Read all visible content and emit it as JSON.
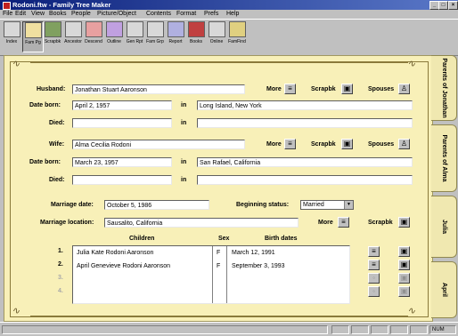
{
  "window": {
    "title": "Rodoni.ftw - Family Tree Maker",
    "controls": [
      "_",
      "□",
      "×"
    ]
  },
  "menu": [
    "File",
    "Edit",
    "View",
    "Books",
    "People",
    "Picture/Object",
    "Contents",
    "Format",
    "Prefs",
    "Help"
  ],
  "toolbar": [
    {
      "label": "Index",
      "icon": "index-icon"
    },
    {
      "label": "Fam Pg",
      "icon": "family-page-icon"
    },
    {
      "label": "Scrapbk",
      "icon": "scrapbook-icon"
    },
    {
      "label": "Ancestor",
      "icon": "ancestor-tree-icon"
    },
    {
      "label": "Descend",
      "icon": "descendant-tree-icon"
    },
    {
      "label": "Outline",
      "icon": "outline-icon"
    },
    {
      "label": "Gen Rpt",
      "icon": "genealogy-report-icon"
    },
    {
      "label": "Fam Grp",
      "icon": "family-group-icon"
    },
    {
      "label": "Report",
      "icon": "report-icon"
    },
    {
      "label": "Books",
      "icon": "books-icon"
    },
    {
      "label": "Online",
      "icon": "online-icon"
    },
    {
      "label": "FamFind",
      "icon": "family-finder-icon"
    }
  ],
  "form": {
    "husband_label": "Husband:",
    "husband": "Jonathan Stuart Aaronson",
    "date_born_label": "Date born:",
    "husband_born": "April 2, 1957",
    "in_label": "in",
    "husband_born_place": "Long Island, New York",
    "died_label": "Died:",
    "husband_died": "",
    "husband_died_place": "",
    "wife_label": "Wife:",
    "wife": "Alma Cecilia Rodoni",
    "wife_born": "March 23, 1957",
    "wife_born_place": "San Rafael, California",
    "wife_died": "",
    "wife_died_place": "",
    "more_label": "More",
    "scrapbk_label": "Scrapbk",
    "spouses_label": "Spouses",
    "marriage_date_label": "Marriage date:",
    "marriage_date": "October 5, 1986",
    "beginning_status_label": "Beginning status:",
    "beginning_status": "Married",
    "marriage_location_label": "Marriage location:",
    "marriage_location": "Sausalito, California"
  },
  "children": {
    "headers": {
      "children": "Children",
      "sex": "Sex",
      "birth": "Birth dates"
    },
    "rows": [
      {
        "num": "1.",
        "name": "Julia Kate Rodoni Aaronson",
        "sex": "F",
        "birth": "March 12, 1991"
      },
      {
        "num": "2.",
        "name": "April Genevieve Rodoni Aaronson",
        "sex": "F",
        "birth": "September 3, 1993"
      },
      {
        "num": "3.",
        "name": "",
        "sex": "",
        "birth": ""
      },
      {
        "num": "4.",
        "name": "",
        "sex": "",
        "birth": ""
      }
    ]
  },
  "tabs": [
    "Parents of Jonathan",
    "Parents of Alma",
    "Julia",
    "April"
  ],
  "status": {
    "num": "NUM"
  },
  "colors": {
    "panel": "#f8f0b8",
    "title_bar": "#0a1f7a",
    "frame": "#8a7a3a"
  }
}
